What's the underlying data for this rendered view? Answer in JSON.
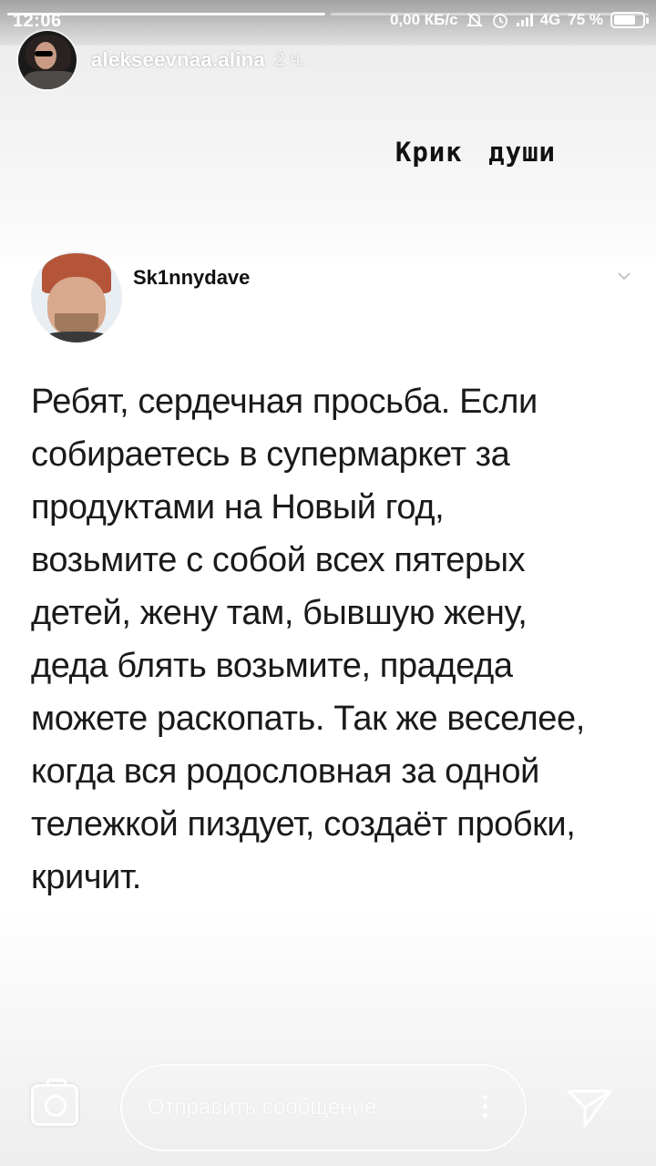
{
  "status_bar": {
    "time": "12:06",
    "network_speed": "0,00 КБ/с",
    "network_type": "4G",
    "battery_percent": "75 %",
    "battery_level": 0.75,
    "icons": [
      "mute-notifications-icon",
      "alarm-icon",
      "signal-icon",
      "battery-icon"
    ]
  },
  "story": {
    "progress_segments": 2,
    "current_segment": 1,
    "author": "alekseevnaa.alina",
    "time_ago": "2 ч.",
    "caption": "Крик души"
  },
  "tweet": {
    "handle": "Sk1nnydave",
    "text": "Ребят, сердечная просьба. Если\nсобираетесь в супермаркет за\nпродуктами на Новый год,\nвозьмите с собой всех пятерых\nдетей, жену там, бывшую жену,\nдеда блять возьмите, прадеда\nможете раскопать. Так же веселее,\nкогда вся родословная за одной\nтележкой пиздует, создаёт пробки,\nкричит."
  },
  "reply_bar": {
    "placeholder": "Отправить сообщение",
    "camera_icon": "camera-icon",
    "send_icon": "send-icon",
    "more_icon": "more-vertical-icon"
  }
}
